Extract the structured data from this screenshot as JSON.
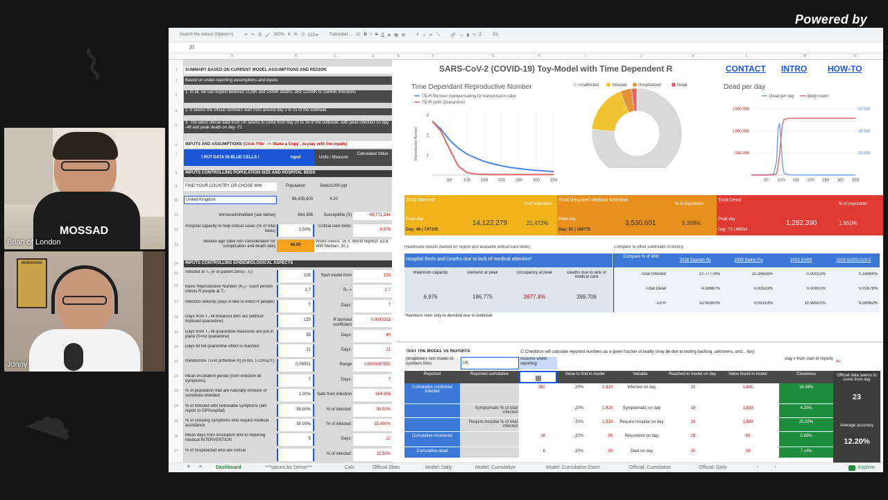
{
  "overlay": {
    "powered": "Powered by",
    "cam1_name": "Brian of London",
    "cam2_name": "Jonny",
    "shirt_text": "MOSSAD",
    "poster_text": "MARIJUANA"
  },
  "toolbar": {
    "search": "Search the menus (Option+/)",
    "zoom": "100%",
    "euro": "€",
    "pct": "%",
    "dec": ".0",
    ".00": ".00",
    "num": "123 ▾",
    "font": "Trebuchet ...",
    "size": "10",
    "bold": "B",
    "italic": "I",
    "strike": "S",
    "color": "A",
    "sigma": "Σ",
    "lang": "Eη"
  },
  "formula_bar": {
    "value": "21"
  },
  "columns": [
    "A",
    "B",
    "C",
    "D",
    "E",
    "F",
    "G",
    "H",
    "I",
    "J",
    "K",
    "L",
    "M",
    "N"
  ],
  "rows": [
    "1",
    "2",
    "3",
    "4",
    "5",
    "6",
    "7",
    "8",
    "9",
    "10",
    "11",
    "12",
    "13",
    "14",
    "15",
    "16",
    "17",
    "18",
    "19",
    "20",
    "21",
    "22",
    "23",
    "24",
    "25",
    "26",
    "27"
  ],
  "left": {
    "r1": "SUMMARY BASED ON CURRENT MODEL ASSUMPTIONS AND REGION",
    "r2": "Based on under-reporting assumptions and inputs:",
    "r3": "1. In all, we can expect between 1126K and 1439K deaths, and 12399K to 15845K infections",
    "r4": "2. It seems the official numbers start from around day 3 to 15 of the outbreak.",
    "r5": "3. The latest official data from UK seems to come from day 20 to 26 of the outbreak, with peak infection on day -48 and peak death on day -72",
    "r6a": "INPUTS AND ASSUMPTIONS ",
    "r6b": "(Click 'File' --> 'Make a Copy', to play with the inputs)",
    "r7": [
      "! PUT DATA IN BLUE CELLS !",
      "Input",
      "Units / Measure",
      "Calculated Value"
    ],
    "r8": "INPUTS CONTROLLING POPULATION SIZE AND HOSPITAL BEDS",
    "r9": [
      "FIND YOUR COUNTRY OR CHOSE WW",
      "Population",
      "Beds/1000 ppl"
    ],
    "r10": [
      "United Kingdom",
      "66,435,600",
      "4.20"
    ],
    "r11": [
      "Immuned/shielded (see below)",
      "664,356",
      "Susceptible (S)",
      "65,771,244"
    ],
    "r12": [
      "Hospital capacity to help critical cases (% of total beds)",
      "2.50%",
      "Critical care beds:",
      "6,976"
    ],
    "r13": [
      "Median age (take into consideration for complication and death rate)",
      "40.50",
      "World lowest: 15.3. World highest: 52.4. WW Median: 30.1"
    ],
    "r14": "INPUTS CONTROLLING EPIDEMIOLOGICAL ASPECTS",
    "params": [
      [
        "Infected at T₀ (# of patient zeros - I₀)",
        "100",
        "Start model from",
        "100"
      ],
      [
        "Basic Reproductive Number (R₀) - Each person infects R people at T₀",
        "2.7",
        "R₀ =",
        "2.7"
      ],
      [
        "Infection velocity (days it take to infect R people)",
        "7",
        "Days:",
        "7"
      ],
      [
        "Days from T₀ till breakout dies out (without imposed quarantine)",
        "120",
        "R burnout coefficient",
        "0.0083333"
      ],
      [
        "Days from T₀ till quarantine measures are put in place (0=no quarantine)",
        "55",
        "Days:",
        "40"
      ],
      [
        "Days till full quarantine effect is reached",
        "21",
        "Days:",
        "21"
      ],
      [
        "Randomize TD-R [Effective R] (0-No, 1-CRAZY)",
        "0.00001",
        "Range",
        "0.0000187692"
      ],
      [
        "Mean incubation period (from infection till symptoms)",
        "7",
        "Days:",
        "7"
      ],
      [
        "% of population that are naturally immune or somehow shielded",
        "1.00%",
        "Safe from infection",
        "664,356"
      ],
      [
        "% of infected with noticeable symptoms (will report to GP/hospital)",
        "50.00%",
        "% of infected:",
        "50.00%"
      ],
      [
        "% of showing symptoms who require medical assistance",
        "50.00%",
        "% of infected:",
        "25.000%"
      ],
      [
        "Mean days from incubation end to requiring medical INTERVENTION",
        "5",
        "Days:",
        "12"
      ],
      [
        "% of hospitalized who are critical",
        "",
        "% of infected:",
        "12.50%"
      ]
    ]
  },
  "top": {
    "title": "SARS-CoV-2 (COVID-19) Toy-Model with Time Dependent R",
    "contact": "CONTACT",
    "intro": "INTRO",
    "howto": "HOW-TO"
  },
  "chart_data": [
    {
      "type": "line",
      "title": "Time Dependant Reproductive Number",
      "ylabel": "Reproductive Number",
      "x": [
        0,
        25,
        50,
        75,
        100,
        125,
        150,
        175,
        200,
        225,
        250,
        275,
        300,
        325,
        350
      ],
      "xticks": [
        50,
        100,
        150,
        200,
        250,
        300,
        350
      ],
      "yticks": [
        1,
        2,
        3
      ],
      "ylim": [
        0,
        3.2
      ],
      "series": [
        {
          "name": "TD-R Burnout (compensating for transmission rate)",
          "color": "#4a86e8",
          "values": [
            2.7,
            2.3,
            1.75,
            1.35,
            1.05,
            0.85,
            0.68,
            0.56,
            0.46,
            0.38,
            0.32,
            0.27,
            0.23,
            0.2,
            0.17
          ]
        },
        {
          "name": "TD-R (with Quarantine)",
          "color": "#e06666",
          "values": [
            2.7,
            2.2,
            1.3,
            0.45,
            0.12,
            0.05,
            0.03,
            0.02,
            0.02,
            0.02,
            0.02,
            0.02,
            0.02,
            0.02,
            0.02
          ]
        }
      ]
    },
    {
      "type": "pie",
      "legend": [
        "Unaffected",
        "Infected",
        "Hospitalized",
        "Dead"
      ],
      "colors": [
        "#d9d9d9",
        "#f1c232",
        "#e69138",
        "#e06666"
      ],
      "values": [
        76.4,
        17.6,
        4.1,
        1.9
      ]
    },
    {
      "type": "line",
      "title": "Dead per day",
      "x": [
        0,
        25,
        50,
        75,
        85,
        90,
        95,
        100,
        105,
        110,
        125,
        150,
        175,
        200,
        225,
        250,
        275,
        300,
        325,
        350
      ],
      "xticks": [
        50,
        100,
        150,
        200,
        250,
        300,
        350
      ],
      "yticks_left": [
        "500,000",
        "1,000,000",
        "1,500,000"
      ],
      "yticks_right": [
        "20,000",
        "40,000",
        "60,000"
      ],
      "series": [
        {
          "name": "Dead per day",
          "color": "#6d9eeb",
          "values": [
            0,
            0,
            0,
            800,
            12000,
            42000,
            46694,
            30000,
            9000,
            1500,
            200,
            50,
            20,
            10,
            5,
            3,
            2,
            1,
            1,
            1
          ]
        },
        {
          "name": "Body count",
          "color": "#e06666",
          "values": [
            0,
            0,
            0,
            1000,
            30000,
            200000,
            450000,
            850000,
            1150000,
            1250000,
            1281000,
            1282000,
            1282300,
            1282390,
            1282390,
            1282390,
            1282390,
            1282390,
            1282390,
            1282390
          ]
        }
      ]
    }
  ],
  "summary": {
    "infected": {
      "title": "Total Infected",
      "pct_label": "% of population",
      "peak": "Peak day",
      "day": "Day: 48 |  747100",
      "value": "14,122,279",
      "pct": "21.472%"
    },
    "medical": {
      "title": "Total Required Medical Attention",
      "pct_label": "% of population",
      "peak": "Peak day",
      "day": "Day: 61 |  186775",
      "value": "3,530,601",
      "pct": "5.368%"
    },
    "dead": {
      "title": "Total Dead",
      "pct_label": "% of population",
      "peak": "Peak day",
      "day": "Day: 72 |  46694",
      "value": "1,282,390",
      "pct": "1.950%"
    }
  },
  "hc": {
    "caption": "Healthcare results (based on region and available critical-care beds)",
    "header": "Hospital Beds and Deaths due to lack of medical attention*",
    "cols": [
      "Maximum capacity",
      "Demand at peak",
      "Occupancy at peak",
      "Deaths due to lack of medical care"
    ],
    "vals": [
      "6,976",
      "186,775",
      "2677.4%",
      "399,706"
    ],
    "note": "*Numbers refer only to demand due to outbreak"
  },
  "cmp": {
    "caption": "Compare to other outbreaks in history",
    "head": [
      "Compare % of WW",
      "1918 Spanish flu",
      "2009 Swine Flu",
      "2003 SARS",
      "2019 SARS-CoV-2"
    ],
    "rows": [
      [
        "-Total Infected",
        "27.77778%",
        "10.34559%",
        "0.00013%",
        "0.18494%"
      ],
      [
        "-Total Dead",
        "4.16667%",
        "0.00533%",
        "0.00001%",
        "0.01679%"
      ],
      [
        "-CFR",
        "15.00000%",
        "0.05153%",
        "10.99501%",
        "9.08062%"
      ]
    ]
  },
  "test": {
    "title": "TEST THE MODEL VS REPORTS",
    "checkbox_note": "☑ Checkbox will calculate reported numbers as a given fraction of reality (may be due to testing backlog, unknowns, and... lies)",
    "dropdown_label": "(dropdown) Test model vs numbers from",
    "country": "UK",
    "assume": "Assume under reporting",
    "dayfrom_label": "Day # from start of reports",
    "dayfrom": "40",
    "head": [
      "Reported",
      "Reported cumulative",
      "",
      "Value to find in model",
      "Variable",
      "Reached in model on day",
      "Value found in model",
      "Closeness"
    ],
    "rows": [
      [
        "Cumulative confirmed Infected",
        "",
        "382",
        "20%",
        "1,910",
        "Infected on day",
        "10",
        "1,641",
        "16.39%"
      ],
      [
        "",
        "Symptomatic % of total infected",
        "",
        "20%",
        "1,910",
        "Symptomatic on day",
        "19",
        "1,833",
        "4.20%"
      ],
      [
        "",
        "Require hospital % of total infected",
        "",
        "20%",
        "1,910",
        "Require hospital on day",
        "28",
        "1,589",
        "20.20%"
      ],
      [
        "Cumulative recovered",
        "",
        "18",
        "20%",
        "90",
        "Recovered on day",
        "28",
        "85",
        "5.88%"
      ],
      [
        "Cumulative dead",
        "",
        "6",
        "20%",
        "30",
        "Died on day",
        "30",
        "28",
        "7.14%"
      ]
    ],
    "side1": "Official data seems to come from day",
    "side1v": "23",
    "side2": "Average accuracy",
    "side2v": "12.20%"
  },
  "tabs": [
    "Dashboard",
    "***Values for Demo***",
    "Calc",
    "Official Stats",
    "Model: Daily",
    "Model: Cumulative",
    "Model: Cumulative Zoom",
    "Official: Cumulative",
    "Official: Daily"
  ],
  "explore": "Explore"
}
